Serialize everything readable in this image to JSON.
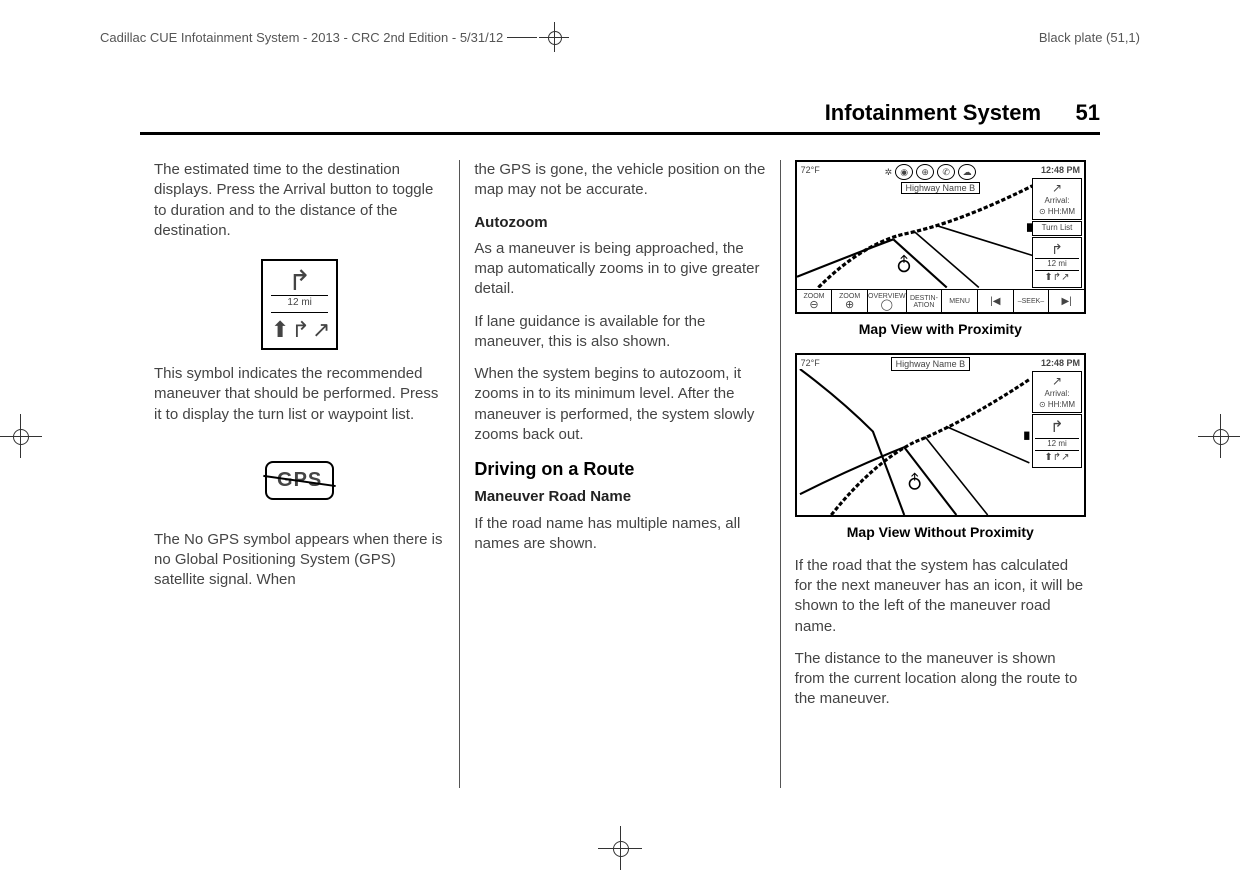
{
  "header": {
    "doc_info": "Cadillac CUE Infotainment System - 2013 - CRC 2nd Edition - 5/31/12",
    "plate": "Black plate (51,1)",
    "section_title": "Infotainment System",
    "page_number": "51"
  },
  "col1": {
    "p1": "The estimated time to the destination displays. Press the Arrival button to toggle to duration and to the distance of the destination.",
    "maneuver_distance": "12 mi",
    "p2": "This symbol indicates the recommended maneuver that should be performed. Press it to display the turn list or waypoint list.",
    "gps_label": "GPS",
    "p3": "The No GPS symbol appears when there is no Global Positioning System (GPS) satellite signal. When"
  },
  "col2": {
    "p1": "the GPS is gone, the vehicle position on the map may not be accurate.",
    "h_autozoom": "Autozoom",
    "p2": "As a maneuver is being approached, the map automatically zooms in to give greater detail.",
    "p3": "If lane guidance is available for the maneuver, this is also shown.",
    "p4": "When the system begins to autozoom, it zooms in to its minimum level. After the maneuver is performed, the system slowly zooms back out.",
    "h_route": "Driving on a Route",
    "h_maneuver": "Maneuver Road Name",
    "p5": "If the road name has multiple names, all names are shown."
  },
  "col3": {
    "map1": {
      "temp": "72°F",
      "time": "12:48 PM",
      "highway": "Highway Name B",
      "arrival_label": "Arrival:",
      "arrival_time": "⊙ HH:MM",
      "turn_list": "Turn List",
      "distance": "12 mi",
      "btn_zoom_out": "ZOOM",
      "btn_zoom_out_sym": "⊖",
      "btn_zoom_in": "ZOOM",
      "btn_zoom_in_sym": "⊕",
      "btn_overview": "OVERVIEW",
      "btn_overview_sym": "◯",
      "btn_dest": "DESTIN-ATION",
      "btn_menu": "MENU",
      "btn_prev": "|◀",
      "btn_seek": "–SEEK–",
      "btn_next": "▶|",
      "caption": "Map View with Proximity"
    },
    "map2": {
      "temp": "72°F",
      "time": "12:48 PM",
      "highway": "Highway Name B",
      "arrival_label": "Arrival:",
      "arrival_time": "⊙ HH:MM",
      "distance": "12 mi",
      "caption": "Map View Without Proximity"
    },
    "p1": "If the road that the system has calculated for the next maneuver has an icon, it will be shown to the left of the maneuver road name.",
    "p2": "The distance to the maneuver is shown from the current location along the route to the maneuver."
  }
}
